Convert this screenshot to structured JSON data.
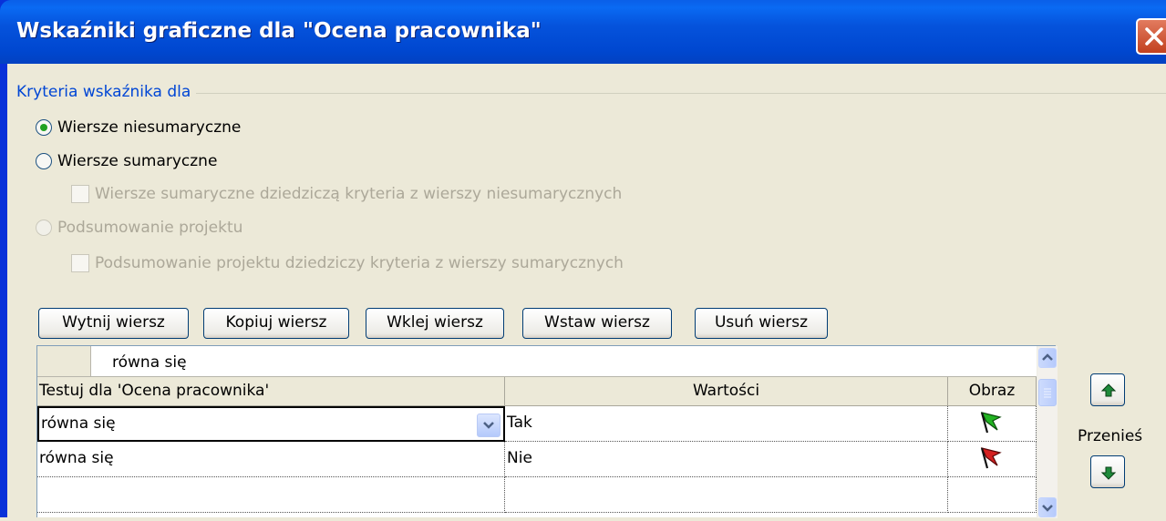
{
  "window": {
    "title": "Wskaźniki graficzne dla \"Ocena pracownika\"",
    "close_icon": "close-x-icon"
  },
  "criteria": {
    "group_label": "Kryteria wskaźnika dla",
    "opt_nonsummary": "Wiersze niesumaryczne",
    "opt_summary": "Wiersze sumaryczne",
    "chk_summary_inherit": "Wiersze sumaryczne dziedziczą kryteria z wierszy niesumarycznych",
    "opt_project": "Podsumowanie projektu",
    "chk_project_inherit": "Podsumowanie projektu dziedziczy kryteria z wierszy sumarycznych",
    "selected": "Wiersze niesumaryczne"
  },
  "toolbar": {
    "cut": "Wytnij wiersz",
    "copy": "Kopiuj wiersz",
    "paste": "Wklej wiersz",
    "insert": "Wstaw wiersz",
    "delete": "Usuń wiersz"
  },
  "grid": {
    "edit_value": "równa się",
    "headers": [
      "Testuj dla 'Ocena pracownika'",
      "Wartości",
      "Obraz"
    ],
    "rows": [
      {
        "test": "równa się",
        "value": "Tak",
        "image": "green-flag-icon"
      },
      {
        "test": "równa się",
        "value": "Nie",
        "image": "red-flag-icon"
      },
      {
        "test": "",
        "value": "",
        "image": ""
      }
    ]
  },
  "move": {
    "label": "Przenieś",
    "up_icon": "arrow-up-icon",
    "down_icon": "arrow-down-icon"
  },
  "colors": {
    "title_bar": "#0553dc",
    "group_label": "#0046d5",
    "flag_green": "#22b422",
    "flag_red": "#d42020"
  }
}
